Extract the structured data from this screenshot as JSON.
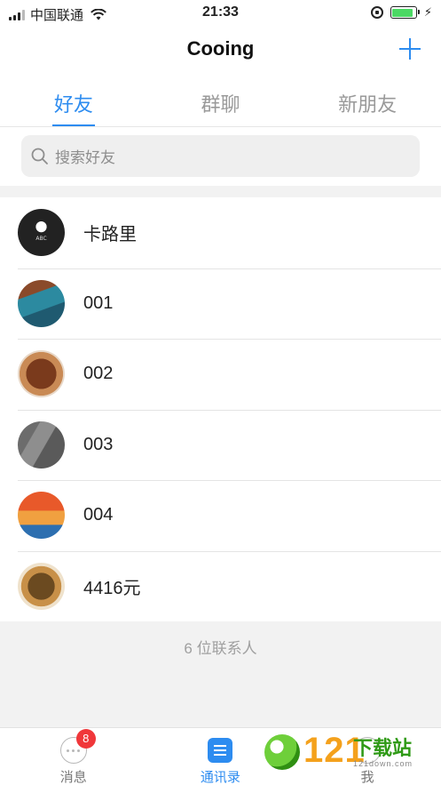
{
  "status_bar": {
    "carrier": "中国联通",
    "time": "21:33",
    "battery_level": 0.9
  },
  "header": {
    "title": "Cooing",
    "add_icon": "plus-icon"
  },
  "tabs": [
    {
      "label": "好友",
      "active": true
    },
    {
      "label": "群聊",
      "active": false
    },
    {
      "label": "新朋友",
      "active": false
    }
  ],
  "search": {
    "placeholder": "搜索好友",
    "icon": "search-icon"
  },
  "contacts": [
    {
      "name": "卡路里",
      "avatar_text": "ABC"
    },
    {
      "name": "001"
    },
    {
      "name": "002"
    },
    {
      "name": "003"
    },
    {
      "name": "004"
    },
    {
      "name": "4416元"
    }
  ],
  "footer": {
    "count_text": "6 位联系人"
  },
  "tab_bar": {
    "items": [
      {
        "label": "消息",
        "icon": "chat-bubble-icon",
        "badge": "8",
        "active": false
      },
      {
        "label": "通讯录",
        "icon": "contacts-book-icon",
        "active": true
      },
      {
        "label": "我",
        "icon": "profile-icon",
        "active": false
      }
    ]
  },
  "watermark": {
    "number": "121",
    "text": "下载站",
    "sub": "121down.com"
  },
  "colors": {
    "accent": "#2d8cf0",
    "badge": "#f0373a"
  }
}
